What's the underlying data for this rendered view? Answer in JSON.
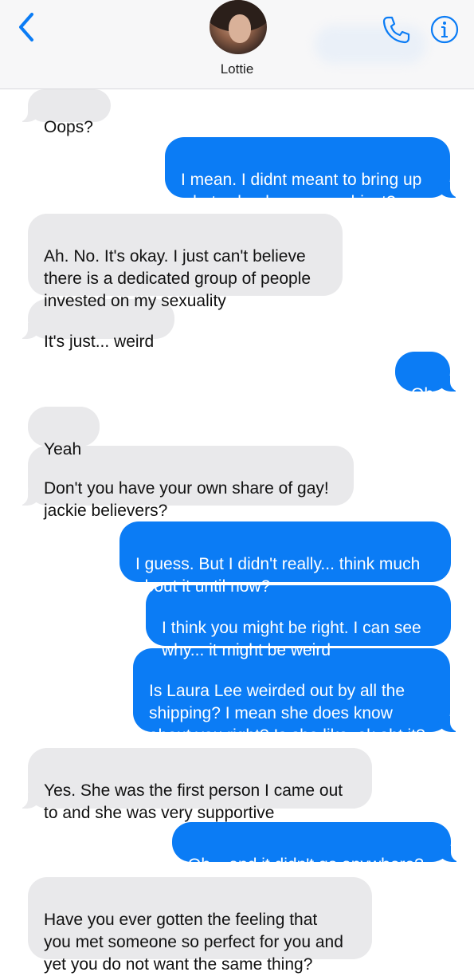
{
  "header": {
    "contact_name": "Lottie",
    "icons": {
      "back": "chevron-left-icon",
      "phone": "phone-icon",
      "info": "info-icon"
    },
    "accent_color": "#0b7cf5"
  },
  "messages": [
    {
      "from": "them",
      "text": "Oops?"
    },
    {
      "from": "me",
      "text": "I mean. I didnt meant to bring up\nwhats clearly a sore subject?"
    },
    {
      "from": "them",
      "text": "Ah. No. It's okay. I just can't believe\nthere is a dedicated group of people\ninvested on my sexuality"
    },
    {
      "from": "them",
      "text": "It's just... weird"
    },
    {
      "from": "me",
      "text": "Oh"
    },
    {
      "from": "them",
      "text": "Yeah"
    },
    {
      "from": "them",
      "text": "Don't you have your own share of gay!\njackie believers?"
    },
    {
      "from": "me",
      "text": "I guess. But I didn't really... think much\nabout it until now?"
    },
    {
      "from": "me",
      "text": "I think you might be right. I can see\nwhy... it might be weird"
    },
    {
      "from": "me",
      "text": "Is Laura Lee weirded out by all the\nshipping? I mean she does know\nabout you right? Is she like, ok abt it?"
    },
    {
      "from": "them",
      "text": "Yes. She was the first person I came out\nto and she was very supportive"
    },
    {
      "from": "me",
      "text": "Oh... and it didn't go anywhere?"
    },
    {
      "from": "them",
      "text": "Have you ever gotten the feeling that\nyou met someone so perfect for you and\nyet you do not want the same thing?"
    }
  ]
}
